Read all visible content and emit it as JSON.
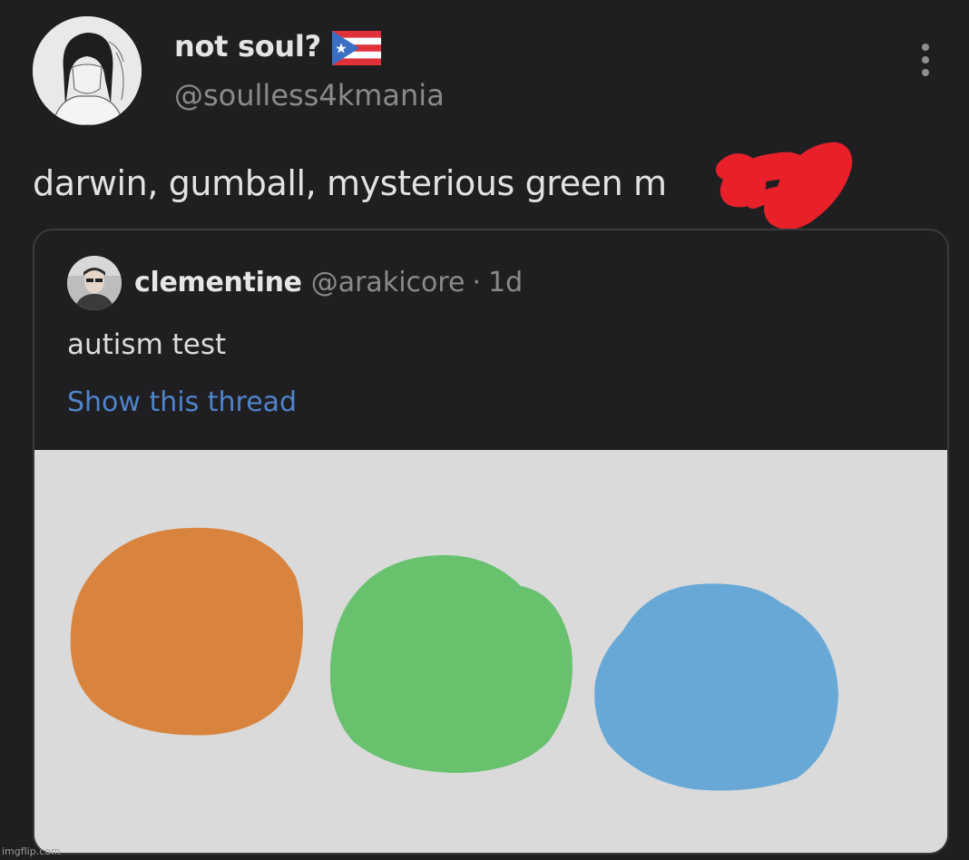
{
  "post": {
    "author": {
      "display_name": "not soul?",
      "flag_icon": "puerto-rico-flag-icon",
      "handle": "@soulless4kmania",
      "avatar_icon": "anime-character-avatar"
    },
    "text": "darwin, gumball, mysterious green m",
    "redaction_color": "#e8202a",
    "more_icon": "vertical-ellipsis-icon"
  },
  "quoted_tweet": {
    "author": {
      "display_name": "clementine",
      "handle": "@arakicore",
      "separator": "·",
      "time": "1d",
      "avatar_icon": "person-photo-avatar"
    },
    "text": "autism test",
    "show_thread_label": "Show this thread",
    "link_color": "#4f83cc",
    "image": {
      "background": "#dadada",
      "blobs": [
        {
          "name": "orange-blob",
          "color": "#d9843e"
        },
        {
          "name": "green-blob",
          "color": "#67c16d"
        },
        {
          "name": "blue-blob",
          "color": "#67a8d6"
        }
      ]
    }
  },
  "watermark": "imgflip.com"
}
